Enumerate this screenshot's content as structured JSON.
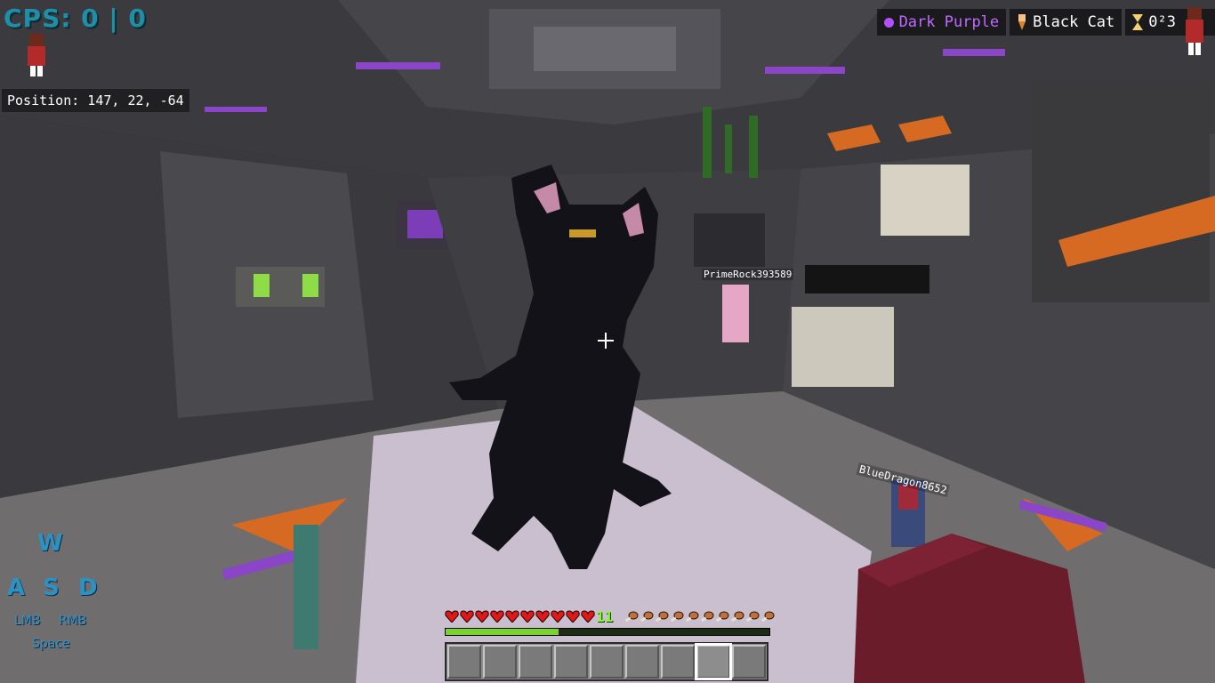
{
  "hud": {
    "cps": "CPS: 0 | 0",
    "position": "Position: 147, 22, -64",
    "color_pill": "Dark Purple",
    "cosmetic_pill": "Black Cat",
    "timer_pill": "0²3",
    "level": "11"
  },
  "keystrokes": {
    "w": "W",
    "a": "A",
    "s": "S",
    "d": "D",
    "lmb": "LMB",
    "rmb": "RMB",
    "space": "Space"
  },
  "nametags": {
    "prime_rock": "PrimeRock393589",
    "blue_dragon": "BlueDragon8652"
  },
  "stats": {
    "hearts_full": 10,
    "hearts_total": 10,
    "food_full": 10,
    "food_total": 10,
    "xp_progress": 0.35,
    "hotbar_slots": 9,
    "selected_slot": 8
  },
  "colors": {
    "cps": "#1f8fa8",
    "accent_purple": "#b44fff",
    "keystroke": "#2b92c4",
    "level": "#7fff20",
    "heart": "#e01818",
    "food": "#c0703a"
  }
}
